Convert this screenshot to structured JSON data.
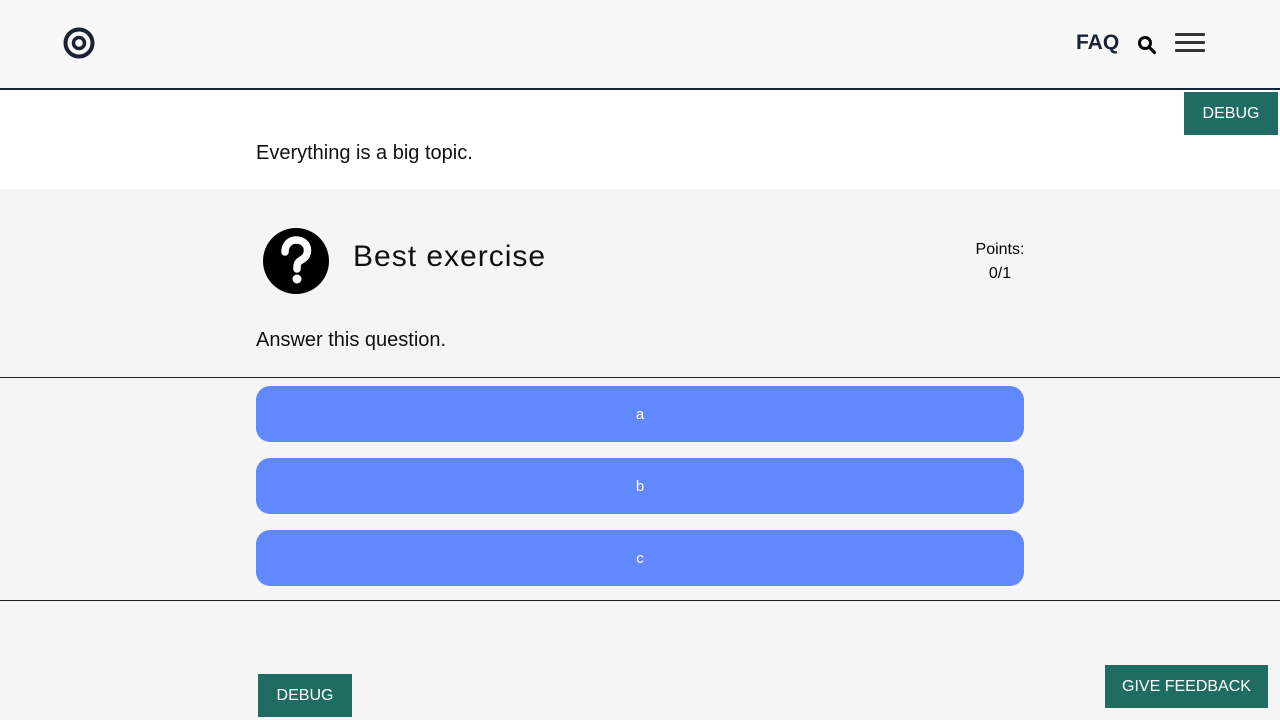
{
  "header": {
    "logo_icon": "target-logo-icon",
    "faq_label": "FAQ",
    "search_icon": "search-icon",
    "menu_icon": "hamburger-menu-icon"
  },
  "intro": {
    "text": "Everything is a big topic."
  },
  "debug_top_label": "DEBUG",
  "exercise": {
    "icon": "question-circle-icon",
    "title": "Best exercise",
    "points_label": "Points:",
    "points_value": "0/1",
    "question": "Answer this question.",
    "options": [
      "a",
      "b",
      "c"
    ]
  },
  "debug_bottom_label": "DEBUG",
  "feedback_label": "GIVE FEEDBACK",
  "colors": {
    "accent_green": "#216c62",
    "option_blue": "#6188fe",
    "header_dark": "#1a2333"
  }
}
